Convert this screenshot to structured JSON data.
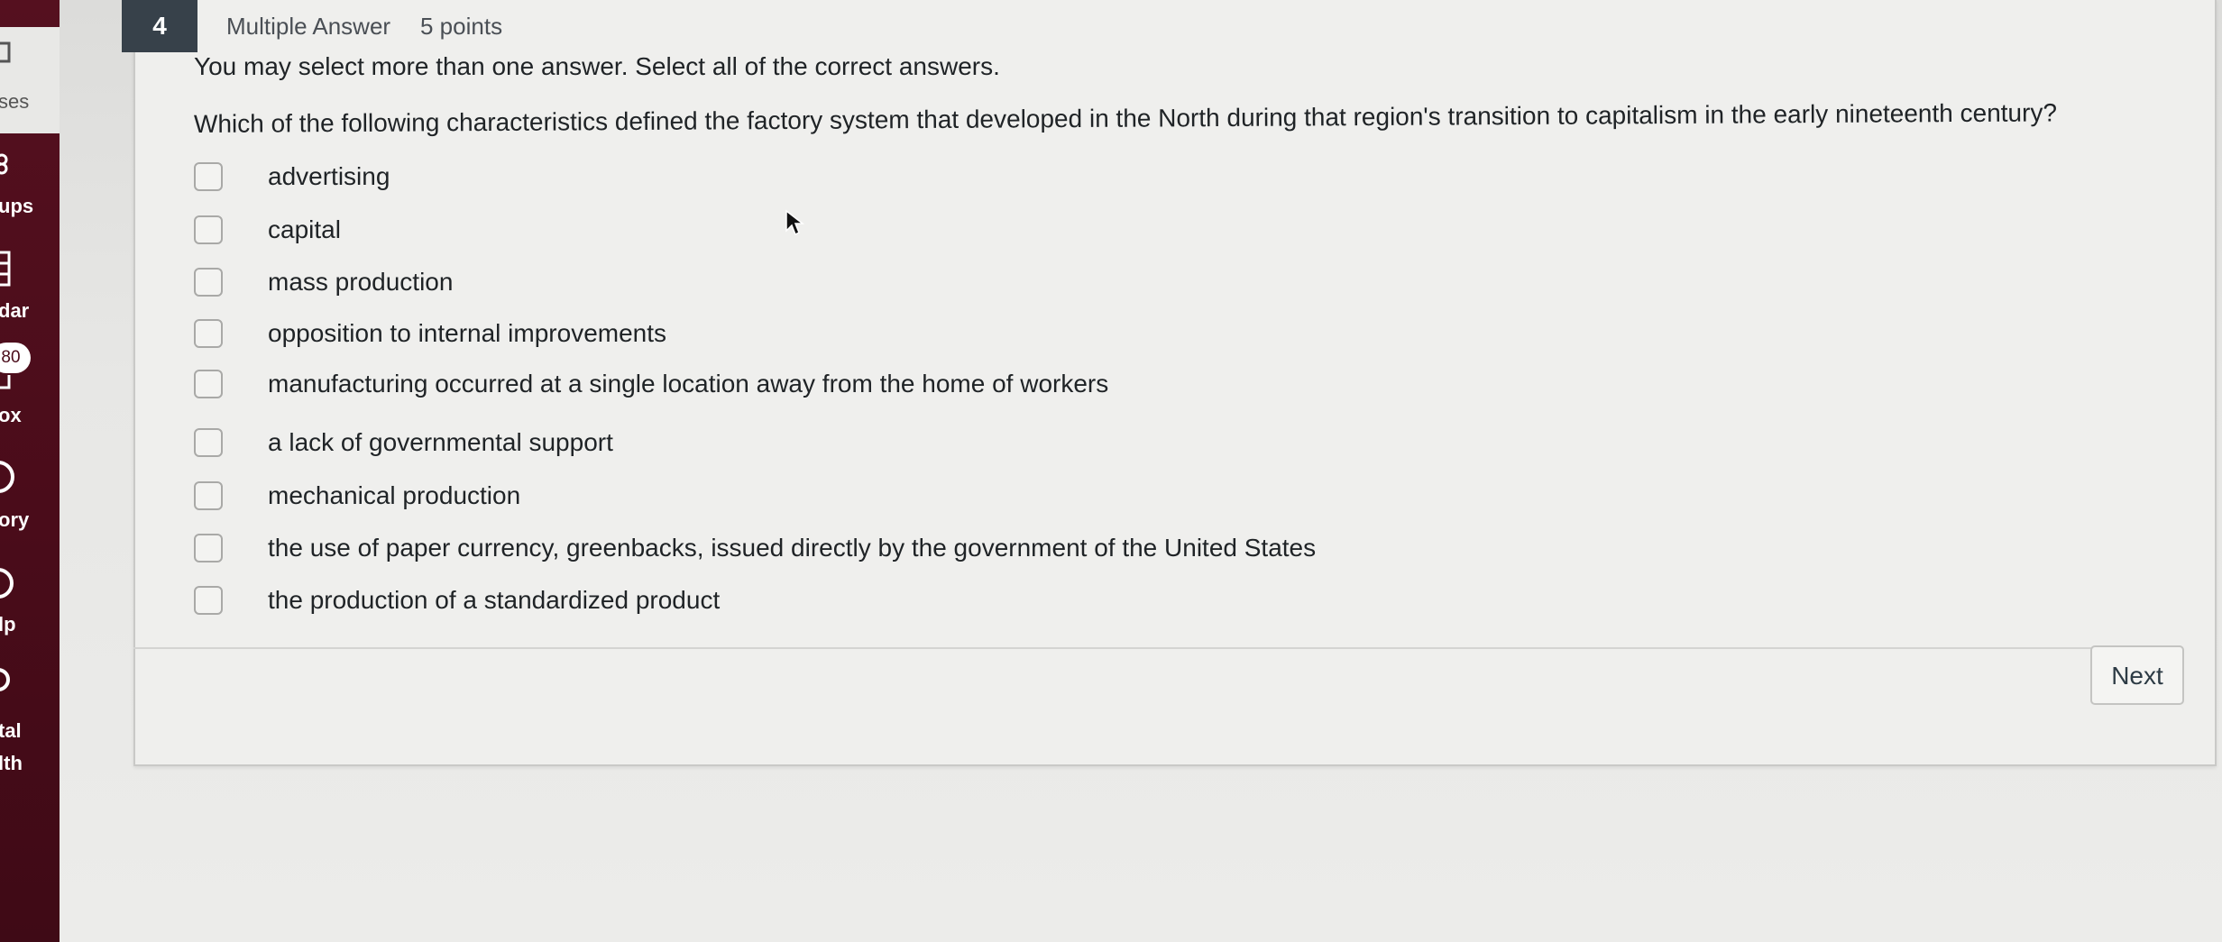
{
  "nav": {
    "items": [
      {
        "label": "ses"
      },
      {
        "label": "ups"
      },
      {
        "label": "dar"
      },
      {
        "label": "ox"
      },
      {
        "label": "ory"
      },
      {
        "label": "lp"
      },
      {
        "label": "tal"
      },
      {
        "label": "lth"
      }
    ],
    "inbox_badge": "80"
  },
  "question": {
    "number": "4",
    "type": "Multiple Answer",
    "points": "5 points",
    "instructions": "You may select more than one answer. Select all of the correct answers.",
    "text": "Which of the following characteristics defined the factory system that developed in the North during that region's transition to capitalism in the early nineteenth century?",
    "answers": [
      {
        "label": "advertising",
        "checked": false
      },
      {
        "label": "capital",
        "checked": false
      },
      {
        "label": "mass production",
        "checked": false
      },
      {
        "label": "opposition to internal improvements",
        "checked": false
      },
      {
        "label": "manufacturing occurred at a single location away from the home of workers",
        "checked": false
      },
      {
        "label": "a lack of governmental support",
        "checked": false
      },
      {
        "label": "mechanical production",
        "checked": false
      },
      {
        "label": "the use of paper currency, greenbacks, issued directly by the government of the United States",
        "checked": false
      },
      {
        "label": "the production of a standardized product",
        "checked": false
      }
    ]
  },
  "footer": {
    "next_label": "Next"
  },
  "colors": {
    "nav_background": "#4a0c1a",
    "question_number_background": "#37414a"
  }
}
